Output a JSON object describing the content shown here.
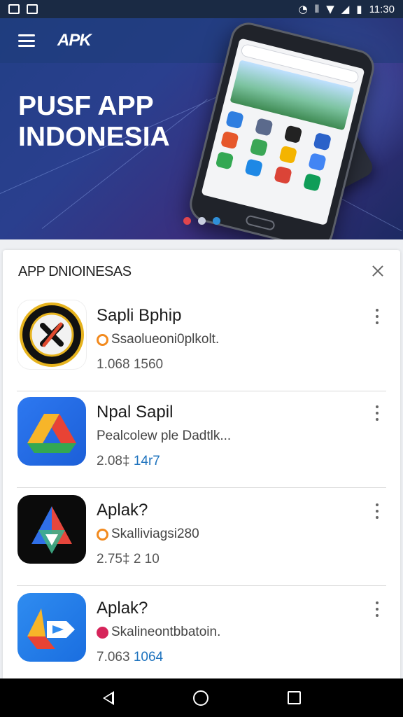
{
  "status_bar": {
    "time": "11:30",
    "icons": [
      "screenshot-icon",
      "image-icon",
      "alarm-icon",
      "vibrate-icon",
      "wifi-icon",
      "signal-icon",
      "battery-icon"
    ]
  },
  "header": {
    "brand": "APK",
    "menu_icon": "menu-icon"
  },
  "hero": {
    "title_line1": "PUSF APP",
    "title_line2": "INDONESIA",
    "carousel_colors": [
      "#e0454d",
      "#c9cfe0",
      "#2f8fd9"
    ]
  },
  "card": {
    "title": "APP DNIOINESAS",
    "close_icon": "close-icon",
    "items": [
      {
        "name": "Sapli Bphip",
        "subtitle": "Ssaolueoni0plkolt.",
        "meta_a": "1.068",
        "meta_b": "1560",
        "badge_color": "#f28a1e",
        "icon": "emblem-logo-icon"
      },
      {
        "name": "Npal Sapil",
        "subtitle": "Pealcolew ple Dadtlk...",
        "meta_a": "2.08‡",
        "meta_b": "14r7",
        "badge_color": "",
        "icon": "drive-triangle-icon"
      },
      {
        "name": "Aplak?",
        "subtitle": "Skalliviagsi280",
        "meta_a": "2.75‡",
        "meta_b": "2 10",
        "badge_color": "#f28a1e",
        "icon": "red-blue-triangle-icon"
      },
      {
        "name": "Aplak?",
        "subtitle": "Skalineontbbatoin.",
        "meta_a": "7.063",
        "meta_b": "1064",
        "badge_color": "#d6245a",
        "icon": "blue-arrow-icon"
      }
    ]
  },
  "nav": {
    "back": "back-icon",
    "home": "home-icon",
    "recents": "recents-icon"
  }
}
